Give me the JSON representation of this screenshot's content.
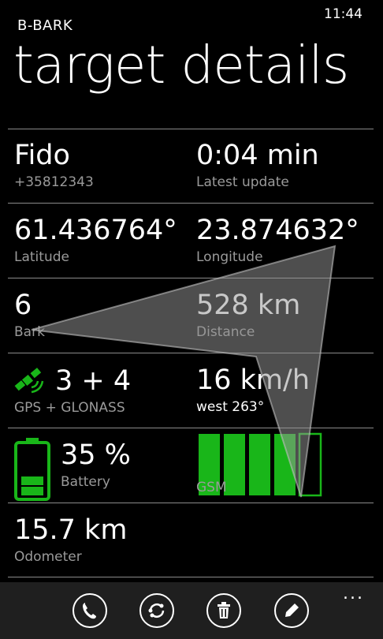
{
  "status": {
    "time": "11:44"
  },
  "app": {
    "name": "B-BARK",
    "page_title": "target details"
  },
  "rows": {
    "target": {
      "name": "Fido",
      "phone": "+35812343"
    },
    "update": {
      "value": "0:04 min",
      "label": "Latest update"
    },
    "latitude": {
      "value": "61.436764°",
      "label": "Latitude"
    },
    "longitude": {
      "value": "23.874632°",
      "label": "Longitude"
    },
    "bark": {
      "value": "6",
      "label": "Bark"
    },
    "distance": {
      "value": "528 km",
      "label": "Distance"
    },
    "satellites": {
      "value": "3 + 4",
      "label": "GPS + GLONASS"
    },
    "speed": {
      "value": "16 km/h",
      "label": "west 263°"
    },
    "battery": {
      "value": "35 %",
      "label": "Battery",
      "level": 0.35
    },
    "gsm": {
      "label": "GSM",
      "bars_filled": 4,
      "bars_total": 5
    },
    "odometer": {
      "value": "15.7 km",
      "label": "Odometer"
    }
  },
  "appbar": {
    "buttons": [
      "phone-icon",
      "sync-icon",
      "delete-icon",
      "edit-icon"
    ],
    "more": "..."
  },
  "colors": {
    "accent": "#19b619",
    "background": "#000000",
    "secondary_text": "#9a9a9a",
    "appbar": "#1f1f1f"
  }
}
